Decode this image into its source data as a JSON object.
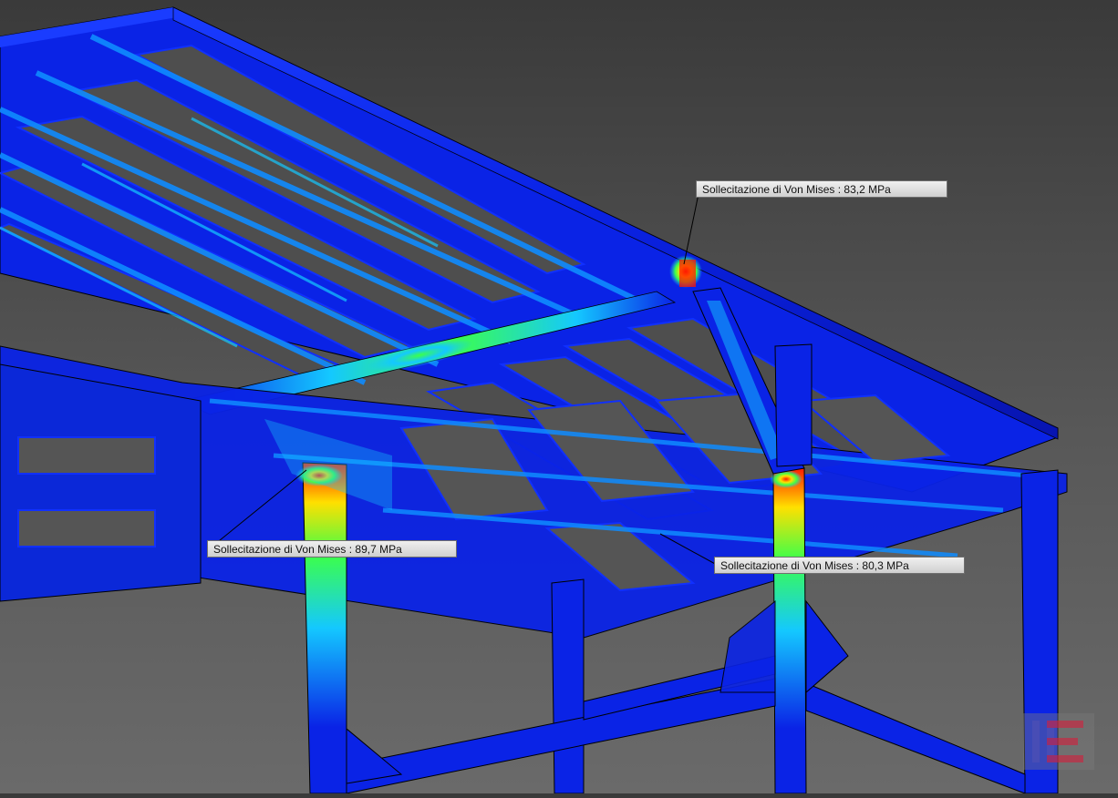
{
  "viewport": {
    "colors": {
      "background_top": "#3a3a3a",
      "background_bottom": "#6a6a6a",
      "stress_low": "#0a23e6",
      "stress_mid_low": "#14c8ff",
      "stress_mid": "#3cff4a",
      "stress_high": "#ffe000",
      "stress_max": "#ff1a00"
    },
    "probes": [
      {
        "id": "probe-1",
        "text": "Sollecitazione di Von Mises : 83,2 MPa",
        "value_mpa": 83.2
      },
      {
        "id": "probe-2",
        "text": "Sollecitazione di Von Mises : 89,7 MPa",
        "value_mpa": 89.7
      },
      {
        "id": "probe-3",
        "text": "Sollecitazione di Von Mises : 80,3 MPa",
        "value_mpa": 80.3
      }
    ]
  },
  "watermark": {
    "icon": "ie-logo-icon",
    "colors": [
      "#5a5aa8",
      "#c0334a"
    ]
  }
}
